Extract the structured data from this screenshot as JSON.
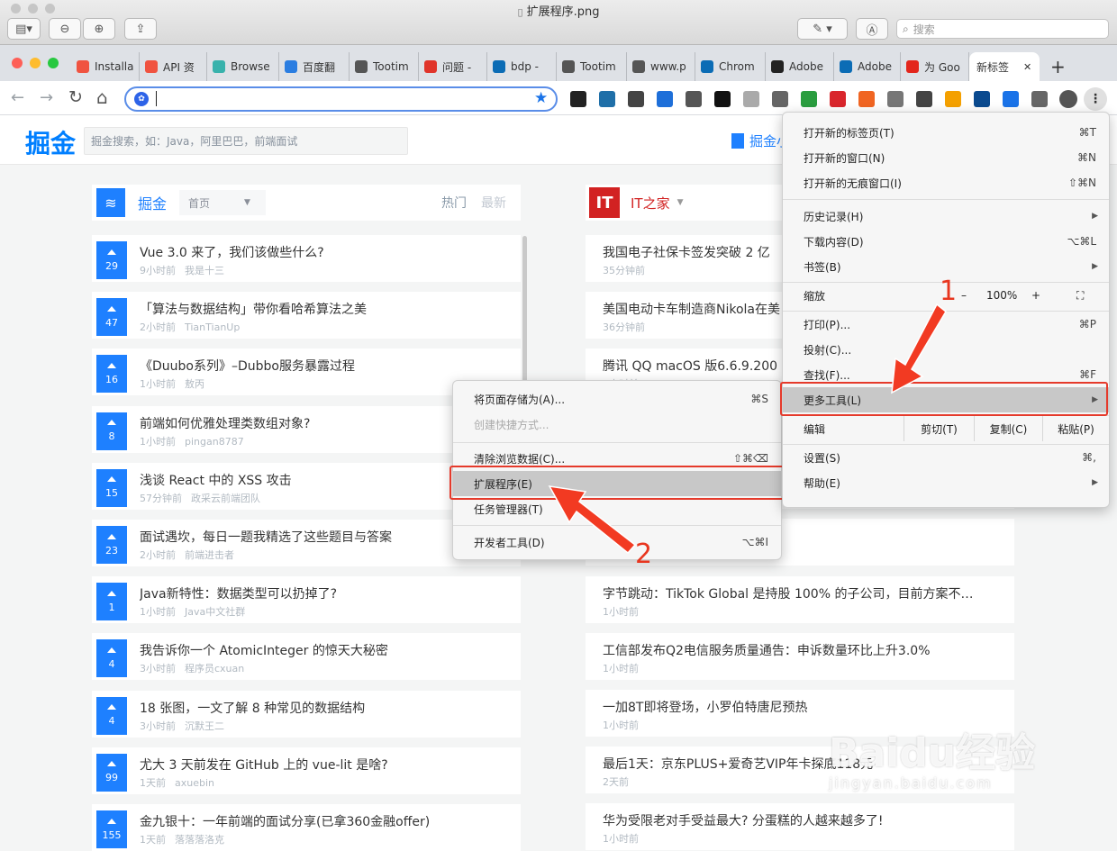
{
  "preview": {
    "title": "扩展程序.png",
    "search_placeholder": "搜索"
  },
  "tabs": [
    {
      "label": "Installa",
      "icon": "laravel-icon",
      "color": "#f05340"
    },
    {
      "label": "API 资",
      "icon": "laravel-icon",
      "color": "#f05340"
    },
    {
      "label": "Browse",
      "icon": "tailwind-icon",
      "color": "#38b2ac"
    },
    {
      "label": "百度翻",
      "icon": "translate-icon",
      "color": "#2a7de1"
    },
    {
      "label": "Tootim",
      "icon": "globe-icon",
      "color": "#555555"
    },
    {
      "label": "问题 -",
      "icon": "arch-icon",
      "color": "#e0342a"
    },
    {
      "label": "bdp - ",
      "icon": "bing-icon",
      "color": "#0b6cb5"
    },
    {
      "label": "Tootim",
      "icon": "globe-icon",
      "color": "#555555"
    },
    {
      "label": "www.p",
      "icon": "globe-icon",
      "color": "#555555"
    },
    {
      "label": "Chrom",
      "icon": "bing-icon",
      "color": "#0b6cb5"
    },
    {
      "label": "Adobe",
      "icon": "github-icon",
      "color": "#222222"
    },
    {
      "label": "Adobe",
      "icon": "bing-icon",
      "color": "#0b6cb5"
    },
    {
      "label": "为 Goo",
      "icon": "adobe-icon",
      "color": "#e3261c"
    }
  ],
  "active_tab": {
    "label": "新标签",
    "close": "✕",
    "new_tab": "+"
  },
  "nav": {
    "back": "←",
    "forward": "→",
    "reload": "↻",
    "home": "⌂"
  },
  "juejin": {
    "logo": "掘金",
    "search_placeholder": "掘金搜索，如：Java，阿里巴巴，前端面试",
    "top_right": "掘金小",
    "left_col": {
      "source": "掘金",
      "dropdown": "首页",
      "tab_hot": "热门",
      "tab_new": "最新",
      "items": [
        {
          "votes": "29",
          "title": "Vue 3.0 来了，我们该做些什么?",
          "time": "9小时前",
          "author": "我是十三"
        },
        {
          "votes": "47",
          "title": "「算法与数据结构」带你看哈希算法之美",
          "time": "2小时前",
          "author": "TianTianUp"
        },
        {
          "votes": "16",
          "title": "《Duubo系列》–Dubbo服务暴露过程",
          "time": "1小时前",
          "author": "敖丙"
        },
        {
          "votes": "8",
          "title": "前端如何优雅处理类数组对象?",
          "time": "1小时前",
          "author": "pingan8787"
        },
        {
          "votes": "15",
          "title": "浅谈 React 中的 XSS 攻击",
          "time": "57分钟前",
          "author": "政采云前端团队"
        },
        {
          "votes": "23",
          "title": "面试遇坎，每日一题我精选了这些题目与答案",
          "time": "2小时前",
          "author": "前端进击者"
        },
        {
          "votes": "1",
          "title": "Java新特性：数据类型可以扔掉了?",
          "time": "1小时前",
          "author": "Java中文社群"
        },
        {
          "votes": "4",
          "title": "我告诉你一个 AtomicInteger 的惊天大秘密",
          "time": "3小时前",
          "author": "程序员cxuan"
        },
        {
          "votes": "4",
          "title": "18 张图，一文了解 8 种常见的数据结构",
          "time": "3小时前",
          "author": "沉默王二"
        },
        {
          "votes": "99",
          "title": "尤大 3 天前发在 GitHub 上的 vue-lit 是啥?",
          "time": "1天前",
          "author": "axuebin"
        },
        {
          "votes": "155",
          "title": "金九银十：一年前端的面试分享(已拿360金融offer)",
          "time": "1天前",
          "author": "落落落洛克"
        }
      ]
    },
    "right_col": {
      "source": "IT之家",
      "logo_text": "IT",
      "items": [
        {
          "title": "我国电子社保卡签发突破 2 亿",
          "time": "35分钟前"
        },
        {
          "title": "美国电动卡车制造商Nikola在美",
          "time": "36分钟前"
        },
        {
          "title": "腾讯 QQ macOS 版6.6.9.200",
          "time": "1小时前"
        },
        {
          "title": "字节跳动：TikTok Global 是持股 100% 的子公司，目前方案不…",
          "time": "1小时前"
        },
        {
          "title": "工信部发布Q2电信服务质量通告：申诉数量环比上升3.0%",
          "time": "1小时前"
        },
        {
          "title": "一加8T即将登场，小罗伯特唐尼预热",
          "time": "1小时前"
        },
        {
          "title": "最后1天：京东PLUS+爱奇艺VIP年卡探底118元",
          "time": "2天前"
        },
        {
          "title": "华为受限老对手受益最大? 分蛋糕的人越来越多了!",
          "time": "1小时前"
        }
      ]
    }
  },
  "chrome_menu": {
    "new_tab": "打开新的标签页(T)",
    "new_tab_sc": "⌘T",
    "new_window": "打开新的窗口(N)",
    "new_window_sc": "⌘N",
    "incognito": "打开新的无痕窗口(I)",
    "incognito_sc": "⇧⌘N",
    "history": "历史记录(H)",
    "downloads": "下载内容(D)",
    "downloads_sc": "⌥⌘L",
    "bookmarks": "书签(B)",
    "zoom": "缩放",
    "zoom_minus": "–",
    "zoom_value": "100%",
    "zoom_plus": "+",
    "print": "打印(P)...",
    "print_sc": "⌘P",
    "cast": "投射(C)...",
    "find": "查找(F)...",
    "find_sc": "⌘F",
    "more_tools": "更多工具(L)",
    "edit": "编辑",
    "cut": "剪切(T)",
    "copy": "复制(C)",
    "paste": "粘贴(P)",
    "settings": "设置(S)",
    "settings_sc": "⌘,",
    "help": "帮助(E)"
  },
  "submenu": {
    "save_page": "将页面存储为(A)...",
    "save_page_sc": "⌘S",
    "create_shortcut": "创建快捷方式...",
    "clear_data": "清除浏览数据(C)...",
    "clear_data_sc": "⇧⌘⌫",
    "extensions": "扩展程序(E)",
    "task_manager": "任务管理器(T)",
    "dev_tools": "开发者工具(D)",
    "dev_tools_sc": "⌥⌘I"
  },
  "annotations": {
    "step1": "1",
    "step2": "2"
  },
  "watermark": "Baidu经验",
  "watermark_sub": "jingyan.baidu.com",
  "colors": {
    "accent": "#1e80ff",
    "annotation": "#e53a2b",
    "ithome": "#d22222"
  }
}
